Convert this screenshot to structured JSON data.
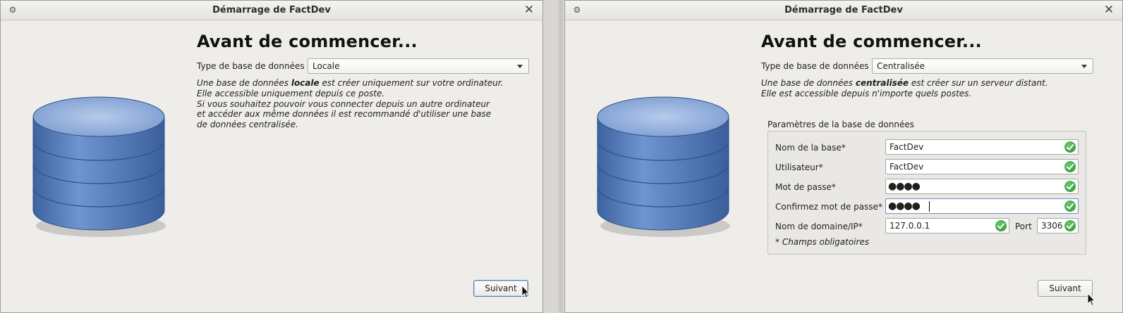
{
  "windows": [
    {
      "title": "Démarrage de FactDev",
      "heading": "Avant de commencer...",
      "type_label": "Type de base de données",
      "type_value": "Locale",
      "description": {
        "line1_pre": "Une base de données ",
        "line1_bold": "locale",
        "line1_post": " est créer uniquement sur votre ordinateur.",
        "line2": "Elle accessible uniquement depuis ce poste.",
        "line3": "Si vous souhaitez pouvoir vous connecter depuis un autre ordinateur",
        "line4": "et accéder aux même données il est recommandé d'utiliser une base",
        "line5": "de données centralisée."
      },
      "next_button": "Suivant"
    },
    {
      "title": "Démarrage de FactDev",
      "heading": "Avant de commencer...",
      "type_label": "Type de base de données",
      "type_value": "Centralisée",
      "description": {
        "line1_pre": "Une base de données ",
        "line1_bold": "centralisée",
        "line1_post": " est créer sur un serveur distant.",
        "line2": "Elle est accessible depuis n'importe quels postes."
      },
      "params": {
        "group_title": "Paramètres de la base de données",
        "db_name_label": "Nom de la base*",
        "db_name_value": "FactDev",
        "user_label": "Utilisateur*",
        "user_value": "FactDev",
        "password_label": "Mot de passe*",
        "password_value": "●●●●",
        "confirm_label": "Confirmez mot de passe*",
        "confirm_value": "●●●●",
        "host_label": "Nom de domaine/IP*",
        "host_value": "127.0.0.1",
        "port_label": "Port",
        "port_value": "3306",
        "required_note": "* Champs obligatoires"
      },
      "next_button": "Suivant"
    }
  ],
  "icons": {
    "window_menu": "gear-icon",
    "close": "close-icon",
    "database": "database-icon",
    "valid": "check-circle-icon",
    "pointer": "mouse-pointer-icon"
  },
  "colors": {
    "window_bg": "#efedea",
    "database_blue": "#4f78b4",
    "valid_green": "#1e8f2b",
    "focus_border": "#5a82b8"
  }
}
